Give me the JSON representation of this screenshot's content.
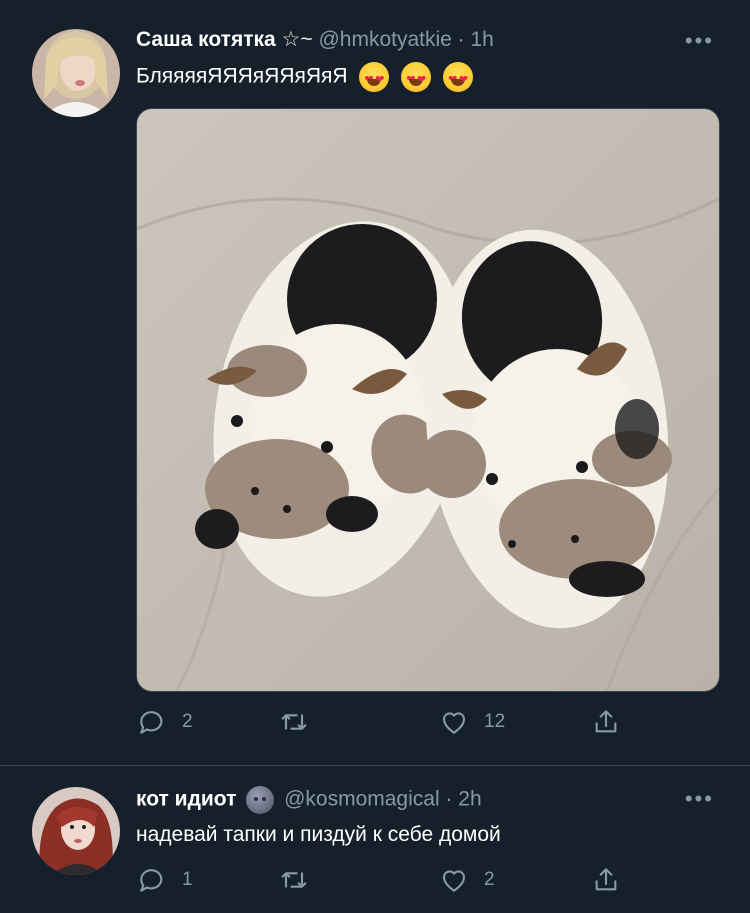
{
  "tweet1": {
    "name": "Саша котятка",
    "name_emoji": "☆~",
    "handle": "@hmkotyatkie · 1h",
    "text": "БляяяяЯЯЯяЯЯяЯяЯ",
    "reply_count": "2",
    "retweet_count": "",
    "like_count": "12",
    "more": "•••",
    "photo_description_icon": "cow-slippers-photo"
  },
  "tweet2": {
    "name": "кот идиот",
    "handle": "@kosmomagical · 2h",
    "text": "надевай тапки и пиздуй к себе домой",
    "reply_count": "1",
    "retweet_count": "",
    "like_count": "2",
    "more": "•••"
  },
  "colors": {
    "background": "#15202b",
    "secondary_text": "#8899a6",
    "divider": "#38444d"
  }
}
